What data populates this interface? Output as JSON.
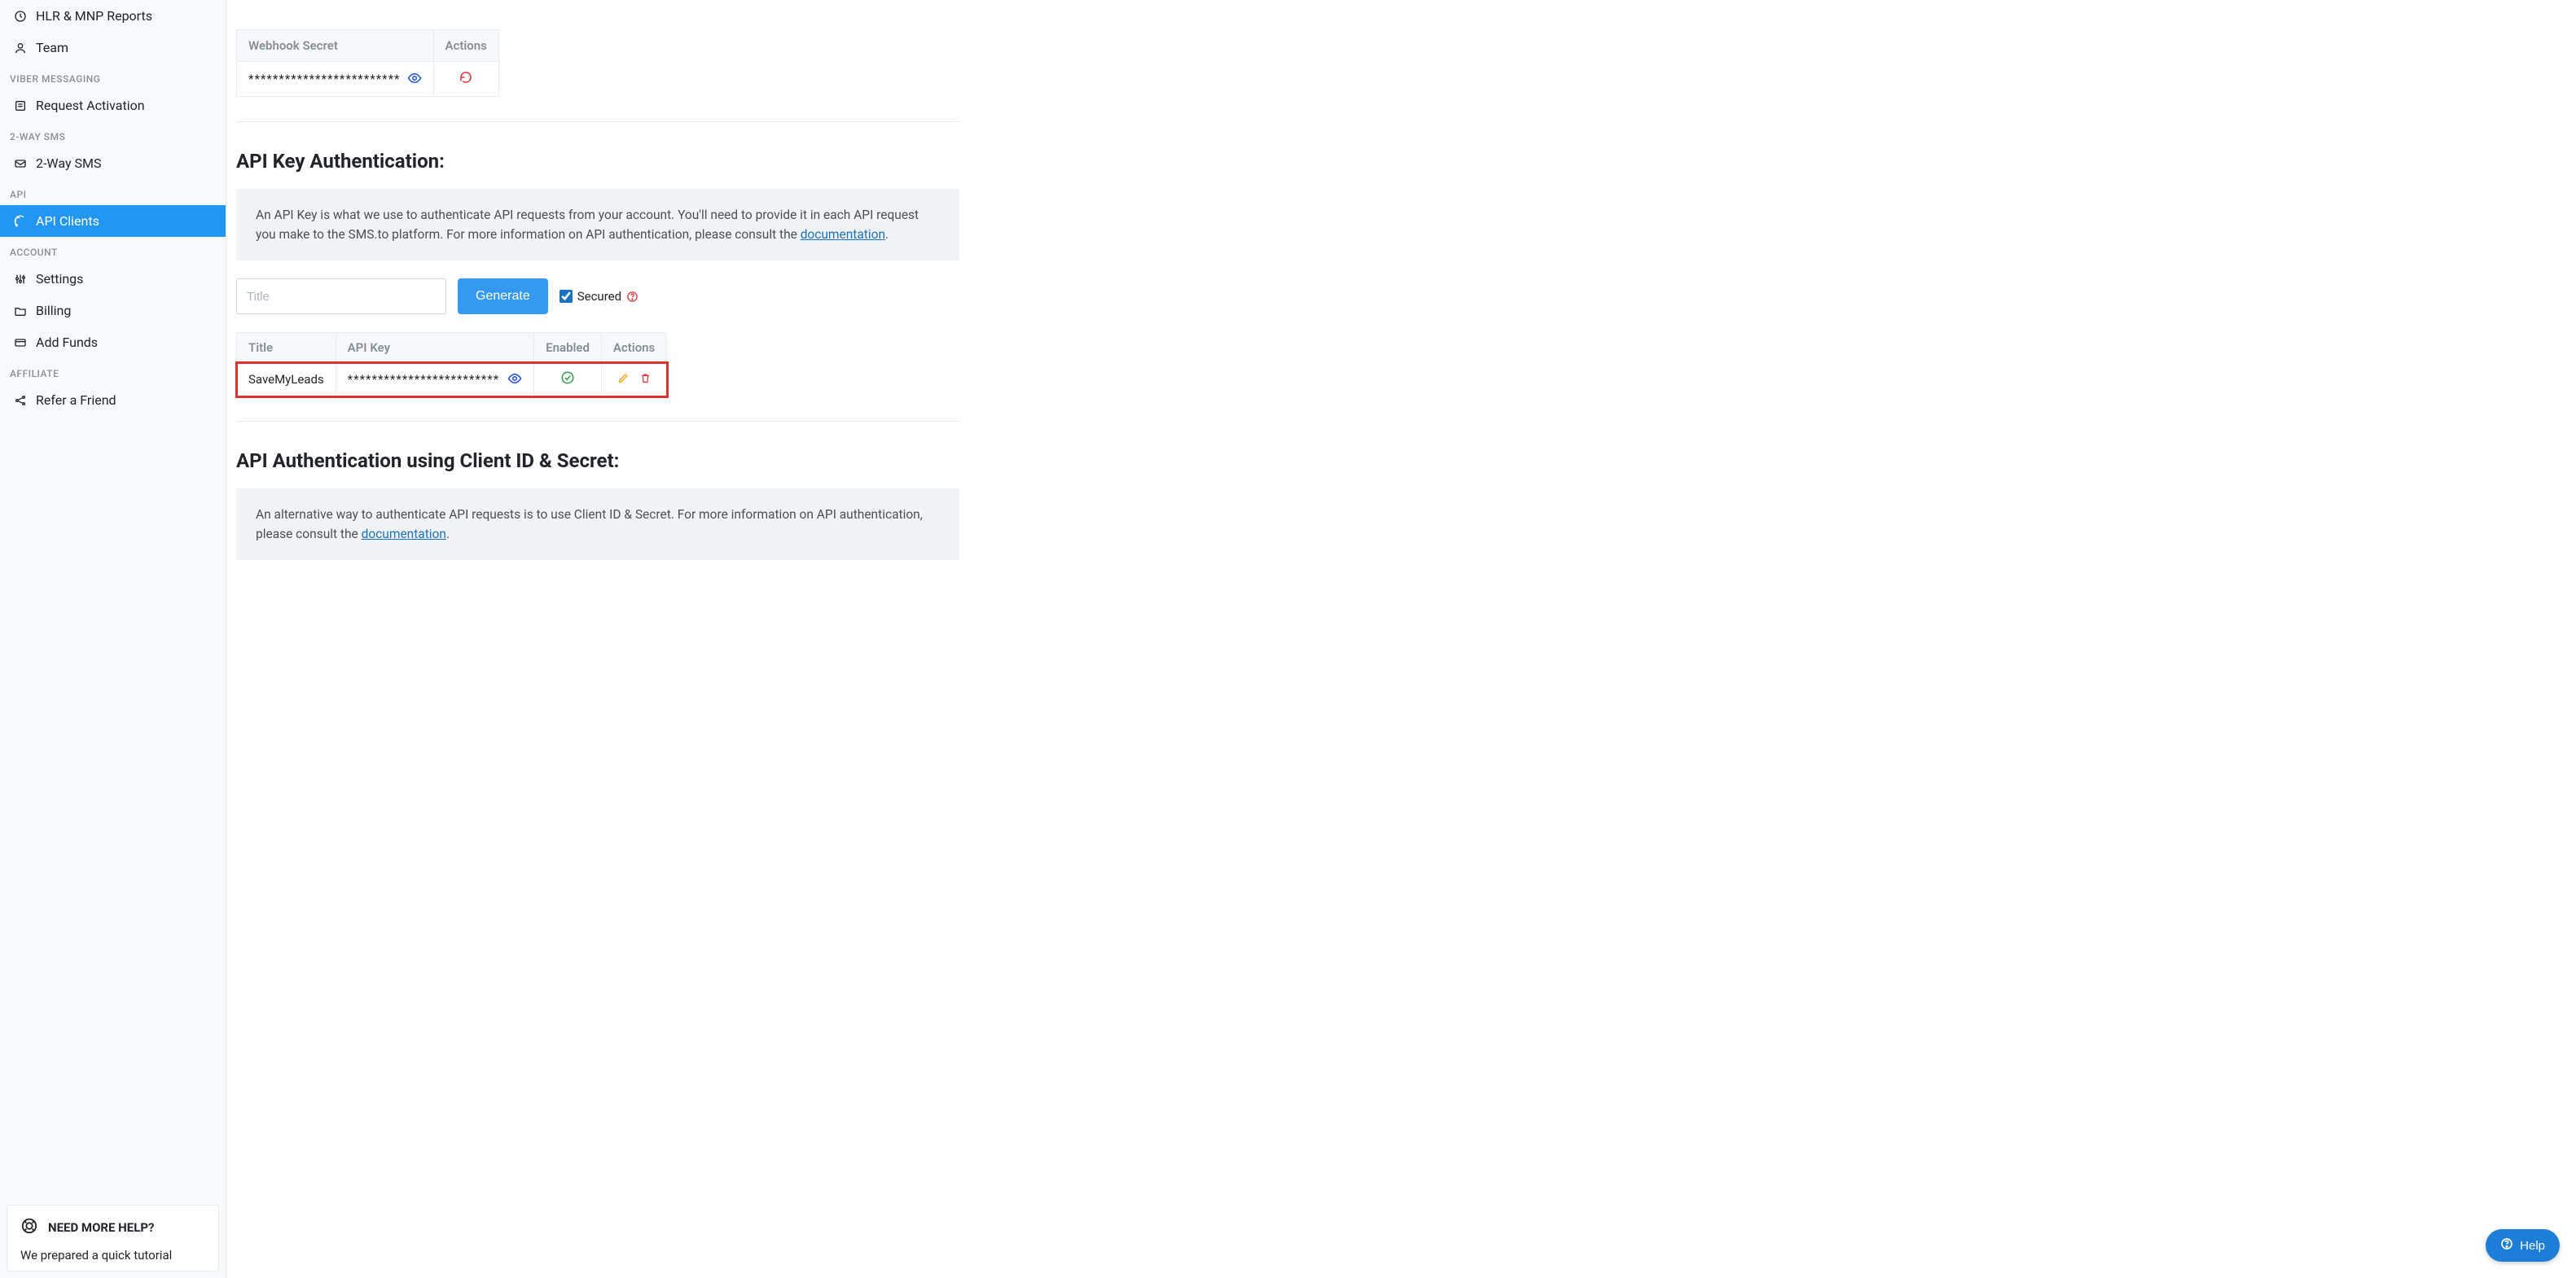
{
  "sidebar": {
    "items": [
      {
        "label": "HLR & MNP Reports"
      },
      {
        "label": "Team"
      }
    ],
    "section_viber": "VIBER MESSAGING",
    "viber_item": "Request Activation",
    "section_2way": "2-WAY SMS",
    "twoway_item": "2-Way SMS",
    "section_api": "API",
    "api_item": "API Clients",
    "section_account": "ACCOUNT",
    "account_items": [
      {
        "label": "Settings"
      },
      {
        "label": "Billing"
      },
      {
        "label": "Add Funds"
      }
    ],
    "section_affiliate": "AFFILIATE",
    "affiliate_item": "Refer a Friend"
  },
  "help_card": {
    "title": "NEED MORE HELP?",
    "body": "We prepared a quick tutorial"
  },
  "webhook_table": {
    "col_secret": "Webhook Secret",
    "col_actions": "Actions",
    "secret_value": "*************************"
  },
  "api_key": {
    "title": "API Key Authentication:",
    "info_text": "An API Key is what we use to authenticate API requests from your account. You'll need to provide it in each API request you make to the SMS.to platform. For more information on API authentication, please consult the ",
    "info_link": "documentation",
    "info_suffix": ".",
    "input_placeholder": "Title",
    "generate_label": "Generate",
    "secured_label": "Secured",
    "table": {
      "col_title": "Title",
      "col_key": "API Key",
      "col_enabled": "Enabled",
      "col_actions": "Actions",
      "row_title": "SaveMyLeads",
      "row_key": "*************************"
    }
  },
  "client_secret": {
    "title": "API Authentication using Client ID & Secret:",
    "info_text": "An alternative way to authenticate API requests is to use Client ID & Secret. For more information on API authentication, please consult the ",
    "info_link": "documentation",
    "info_suffix": "."
  },
  "help_float": "Help"
}
